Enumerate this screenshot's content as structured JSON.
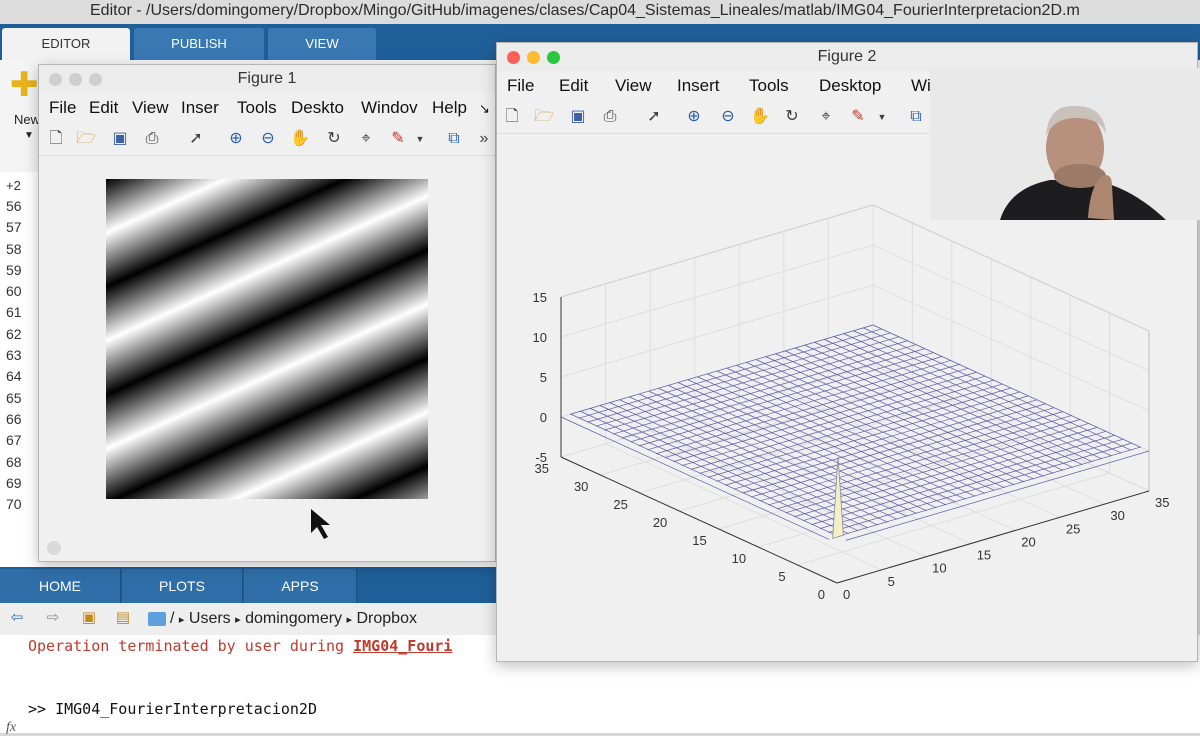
{
  "main_window": {
    "title": "Editor - /Users/domingomery/Dropbox/Mingo/GitHub/imagenes/clases/Cap04_Sistemas_Lineales/matlab/IMG04_FourierInterpretacion2D.m",
    "ribbon_tabs": [
      "EDITOR",
      "PUBLISH",
      "VIEW"
    ],
    "new_label": "New",
    "zoom_chip": "+2",
    "line_numbers": [
      "56",
      "57",
      "58",
      "59",
      "60",
      "61",
      "62",
      "63",
      "64",
      "65",
      "66",
      "67",
      "68",
      "69",
      "70"
    ],
    "bottom_tabs": [
      "HOME",
      "PLOTS",
      "APPS"
    ],
    "path": [
      "/",
      "▸",
      "Users",
      "▸",
      "domingomery",
      "▸",
      "Dropbox"
    ],
    "command_window": {
      "error_prefix": "Operation terminated by user during ",
      "error_link": "IMG04_Fouri",
      "prompt": ">> IMG04_FourierInterpretacion2D",
      "fx": "fx"
    }
  },
  "figure1": {
    "title": "Figure 1",
    "menu": [
      "File",
      "Edit",
      "View",
      "Inser",
      "Tools",
      "Deskto",
      "Windov",
      "Help"
    ],
    "menu_overflow": "↘"
  },
  "figure2": {
    "title": "Figure 2",
    "menu": [
      "File",
      "Edit",
      "View",
      "Insert",
      "Tools",
      "Desktop",
      "Wi"
    ],
    "toolbar_overflow": "»"
  },
  "colors": {
    "ribbon_blue": "#1f5f99",
    "error_red": "#c0392b",
    "mesh_line": "#5a5aa8"
  },
  "chart_data": {
    "type": "surface",
    "xticks": [
      "0",
      "5",
      "10",
      "15",
      "20",
      "25",
      "30",
      "35"
    ],
    "yticks": [
      "0",
      "5",
      "10",
      "15",
      "20",
      "25",
      "30",
      "35"
    ],
    "zticks": [
      "-5",
      "0",
      "5",
      "10",
      "15"
    ],
    "x_range": [
      0,
      35
    ],
    "y_range": [
      0,
      35
    ],
    "z_range": [
      -5,
      15
    ],
    "grid": true,
    "surface_baseline": 0,
    "peak": {
      "x": 1,
      "y": 1,
      "z": 10
    }
  }
}
